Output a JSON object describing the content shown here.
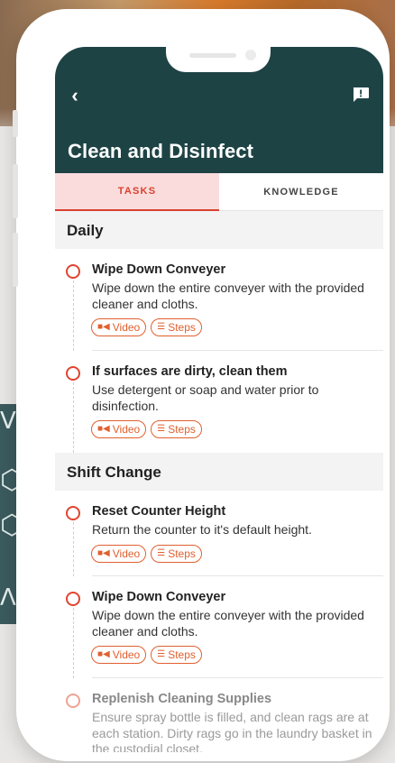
{
  "app": {
    "title": "Clean and Disinfect"
  },
  "header": {
    "back_icon": "chevron-left-icon",
    "back_glyph": "‹",
    "flag_icon": "report-icon"
  },
  "tabs": [
    {
      "label": "TASKS",
      "active": true
    },
    {
      "label": "KNOWLEDGE",
      "active": false
    }
  ],
  "sections": [
    {
      "title": "Daily",
      "tasks": [
        {
          "title": "Wipe Down Conveyer",
          "description": "Wipe down the entire conveyer with the provided cleaner and cloths.",
          "video_label": "Video",
          "steps_label": "Steps"
        },
        {
          "title": "If surfaces are dirty, clean them",
          "description": "Use detergent or soap and water prior to disinfection.",
          "video_label": "Video",
          "steps_label": "Steps"
        }
      ]
    },
    {
      "title": "Shift Change",
      "tasks": [
        {
          "title": "Reset Counter Height",
          "description": "Return the counter to it's default height.",
          "video_label": "Video",
          "steps_label": "Steps"
        },
        {
          "title": "Wipe Down Conveyer",
          "description": "Wipe down the entire conveyer with the provided cleaner and cloths.",
          "video_label": "Video",
          "steps_label": "Steps"
        },
        {
          "title": "Replenish Cleaning Supplies",
          "description": "Ensure spray bottle is filled, and clean rags are at each station. Dirty rags go in the laundry basket in the custodial closet."
        }
      ]
    }
  ],
  "icons": {
    "video": "video-camera-icon",
    "steps": "list-icon"
  },
  "colors": {
    "header_bg": "#1e4345",
    "accent": "#d8412f",
    "pill": "#e0602f",
    "tab_active_bg": "#fadcdc"
  }
}
